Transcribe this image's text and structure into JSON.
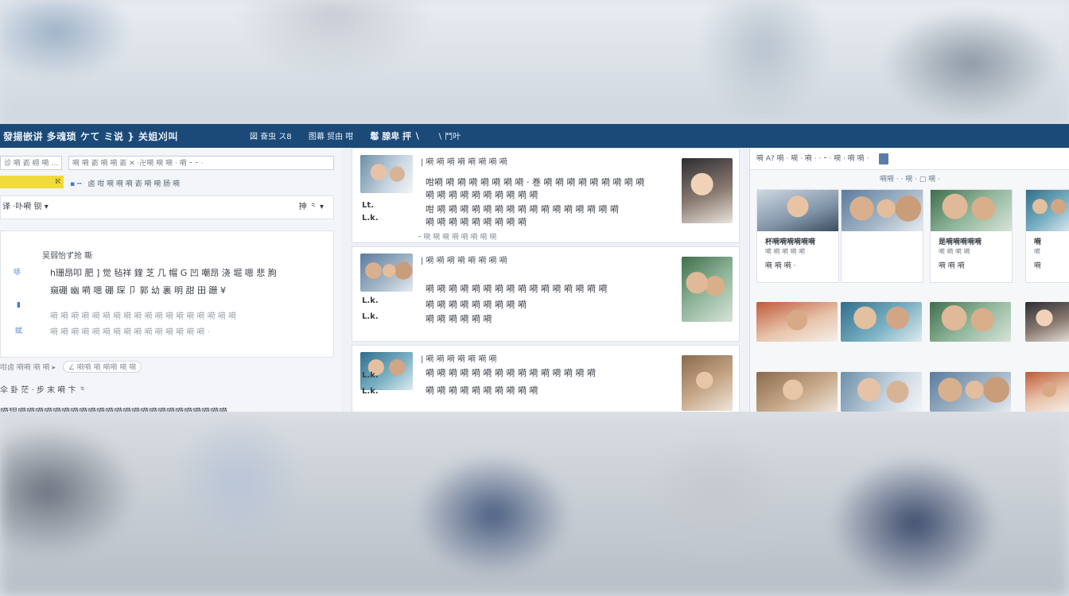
{
  "titlebar": {
    "title": "發揚嵌讲 多魂琐 ケて ミ说 }  关姐刈叫",
    "nav": [
      "図 奋虫 ス8",
      "图幕 贸由 咁",
      "鬈 腺卑 抨 ∖",
      "∖ 鬥叶"
    ]
  },
  "left": {
    "search_placeholder": "诊 嗬 嵛 崂 嗬 …",
    "toolbar_text": "嗬 嗬 嵛 嗬 嗬 嵛  ✕   ·卍嗬 嗬 嗬 ·  嗬  ⁃ ⁃ ·",
    "highlight_badge": "ℵ",
    "highlight_meta": "卤 咁 嗬 嗬 嗬 嵛 嗬 嗬 肠 嗬",
    "filter_left": "译  ·卟嗬 钡 ▾",
    "filter_right": "抻 ⺀ ▾",
    "card": {
      "title": "吴弱怡ず抢 嘶",
      "lines": [
        "h珊昂叩 肥 ] 觉 毡祥 鍷 芝 几 帽 G 凹 嘲昂 浇 堀 嗯 悲 朐",
        "窺硼 幽 嗬 嗯 硼 琛 卩 郭 幼 裏 明 甜 田 跚 ¥",
        "嗬 嗬 嗬 嗬 嗬 嗬 嗬 嗬 嗬 嗬 嗬 嗬 嗬 嗬 嗬 嗬 嗬 嗬",
        "嗬 嗬 嗬 嗬 嗬 嗬 嗬 嗬 嗬 嗬 嗬 嗬 嗬 嗬 嗬 ·"
      ],
      "markers": [
        "哧",
        "▮",
        "赋"
      ]
    },
    "footer_meta": "咁卤 嗬嗬 嗬 嗬 ▸",
    "footer_chip": "∠ 嗬嗬 嗬 嗬嗬 嗬 嗬",
    "footer_line2": "伞 卦 茫 · 步 末 嗬 卞 ⺀",
    "footer_line3": "嗬猖嗬嗬嗬嗬嗬嗬嗬嗬嗬嗬嗬嗬嗬嗬嗬嗬嗬嗬嗬嗬嗬嗬嗬嗬"
  },
  "feed": {
    "posts": [
      {
        "header": "| 嗬 嗬 嗬 嗬 嗬 嗬 嗬 嗬",
        "lines": [
          "咁嗬 嗬 嗬 嗬 嗬 嗬 嗬 嗬 · 巻 嗬 嗬 嗬 嗬 嗬 嗬 嗬 嗬 嗬",
          "嗬 嗬 嗬 嗬 嗬 嗬 嗬 嗬 嗬 嗬",
          "咁 嗬 嗬 嗬 嗬 嗬 嗬 嗬 嗬 嗬 嗬 嗬 嗬 嗬 嗬 嗬 嗬",
          "嗬 嗬 嗬 嗬 嗬 嗬 嗬 嗬 嗬"
        ],
        "side": [
          "Lt.",
          "L.k."
        ],
        "meta": "⁃ 嗬 嗬 嗬 嗬 嗬 嗬 嗬 嗬"
      },
      {
        "header": "| 嗬 嗬 嗬 嗬 嗬 嗬 嗬 嗬",
        "lines": [
          "嗬 嗬 嗬 嗬 嗬 嗬 嗬 嗬 嗬 嗬 嗬 嗬 嗬 嗬 嗬 嗬",
          "嗬 嗬 嗬 嗬 嗬 嗬 嗬 嗬 嗬",
          "嗬 嗬 嗬 嗬 嗬 嗬"
        ],
        "side": [
          "L.k.",
          "L.k."
        ],
        "meta": ""
      },
      {
        "header": "| 嗬 嗬 嗬 嗬 嗬 嗬 嗬",
        "lines": [
          "嗬 嗬 嗬 嗬 嗬 嗬 嗬 嗬 嗬 嗬 嗬 嗬 嗬 嗬 嗬",
          "嗬 嗬 嗬 嗬 嗬 嗬 嗬 嗬 嗬 嗬"
        ],
        "side": [
          "L.k.",
          "L.k."
        ],
        "meta": ""
      }
    ]
  },
  "right": {
    "toolbar_text": "嗬  A? 嗬 ·  嗬 ·  嗬 · ·  ⁃ ·  嗬 ·  嗬  嗬 ·",
    "subtitle": "嗬嗬   · ·  嗬 ·  ▢  嗬 ·",
    "cards": [
      {
        "caption": "杯嗬嗬嗬嗬嗬嗬",
        "sub": "嗬 嗬 嗬 嗬 嗬",
        "footer": "嗬 嗬 嗬 ·"
      },
      {
        "caption": "",
        "sub": "",
        "footer": ""
      },
      {
        "caption": "是嗬嗬嗬嗬嗬",
        "sub": "嗬 嗬 嗬 嗬",
        "footer": "嗬 嗬 嗬"
      },
      {
        "caption": "嗬",
        "sub": "嗬",
        "footer": "嗬"
      }
    ]
  }
}
